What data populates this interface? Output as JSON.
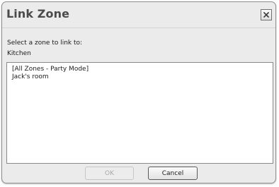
{
  "dialog": {
    "title": "Link Zone",
    "close_icon": "close-x-icon",
    "prompt": "Select a zone to link to:",
    "current_zone": "Kitchen",
    "zones": [
      "[All Zones - Party Mode]",
      "Jack's room"
    ],
    "ok_label": "OK",
    "ok_enabled": false,
    "cancel_label": "Cancel"
  }
}
